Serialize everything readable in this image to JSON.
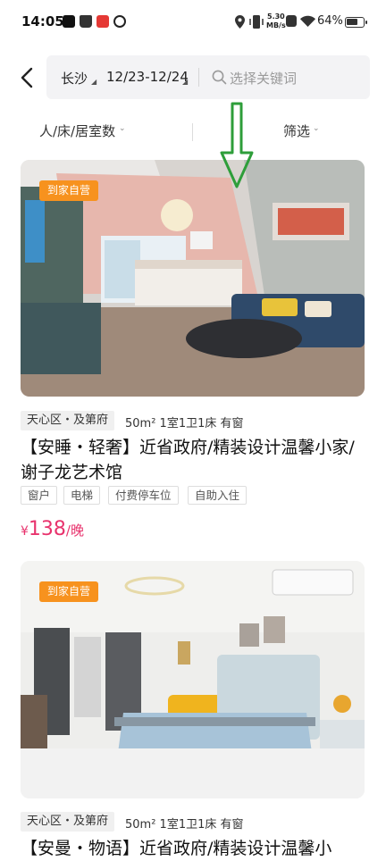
{
  "status_bar": {
    "time": "14:05",
    "net_speed_top": "5.30",
    "net_speed_bottom": "MB/s",
    "battery": "64%"
  },
  "search": {
    "city": "长沙",
    "dates": "12/23-12/24",
    "placeholder": "选择关键词"
  },
  "filters": {
    "room": "人/床/居室数",
    "screen": "筛选"
  },
  "listings": [
    {
      "badge": "到家自营",
      "district": "天心区・及第府",
      "meta": "50m² 1室1卫1床 有窗",
      "title": "【安睡・轻奢】近省政府/精装设计温馨小家/谢子龙艺术馆",
      "features": [
        "窗户",
        "电梯",
        "付费停车位",
        "自助入住"
      ],
      "price_currency": "¥",
      "price": "138",
      "price_unit": "/晚"
    },
    {
      "badge": "到家自营",
      "district": "天心区・及第府",
      "meta": "50m² 1室1卫1床 有窗",
      "title": "【安曼・物语】近省政府/精装设计温馨小"
    }
  ],
  "colors": {
    "badge": "#f7921e",
    "price": "#e8336d",
    "annotation_arrow": "#2e9e3a"
  }
}
